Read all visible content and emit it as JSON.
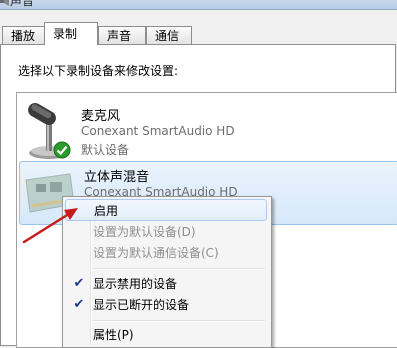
{
  "window": {
    "title": "声音"
  },
  "tabs": [
    {
      "label": "播放"
    },
    {
      "label": "录制"
    },
    {
      "label": "声音"
    },
    {
      "label": "通信"
    }
  ],
  "instruction": "选择以下录制设备来修改设置:",
  "devices": [
    {
      "name": "麦克风",
      "driver": "Conexant SmartAudio HD",
      "status": "默认设备",
      "icon": "microphone-icon",
      "badge": "default-check-icon"
    },
    {
      "name": "立体声混音",
      "driver": "Conexant SmartAudio HD",
      "status": "",
      "icon": "sound-card-icon"
    }
  ],
  "context_menu": {
    "items": [
      {
        "label": "启用",
        "enabled": true
      },
      {
        "label": "设置为默认设备(D)",
        "enabled": false
      },
      {
        "label": "设置为默认通信设备(C)",
        "enabled": false
      },
      {
        "label": "显示禁用的设备",
        "checked": true
      },
      {
        "label": "显示已断开的设备",
        "checked": true
      },
      {
        "label": "属性(P)",
        "enabled": true
      }
    ]
  },
  "annotation": {
    "color": "#c8191b"
  }
}
